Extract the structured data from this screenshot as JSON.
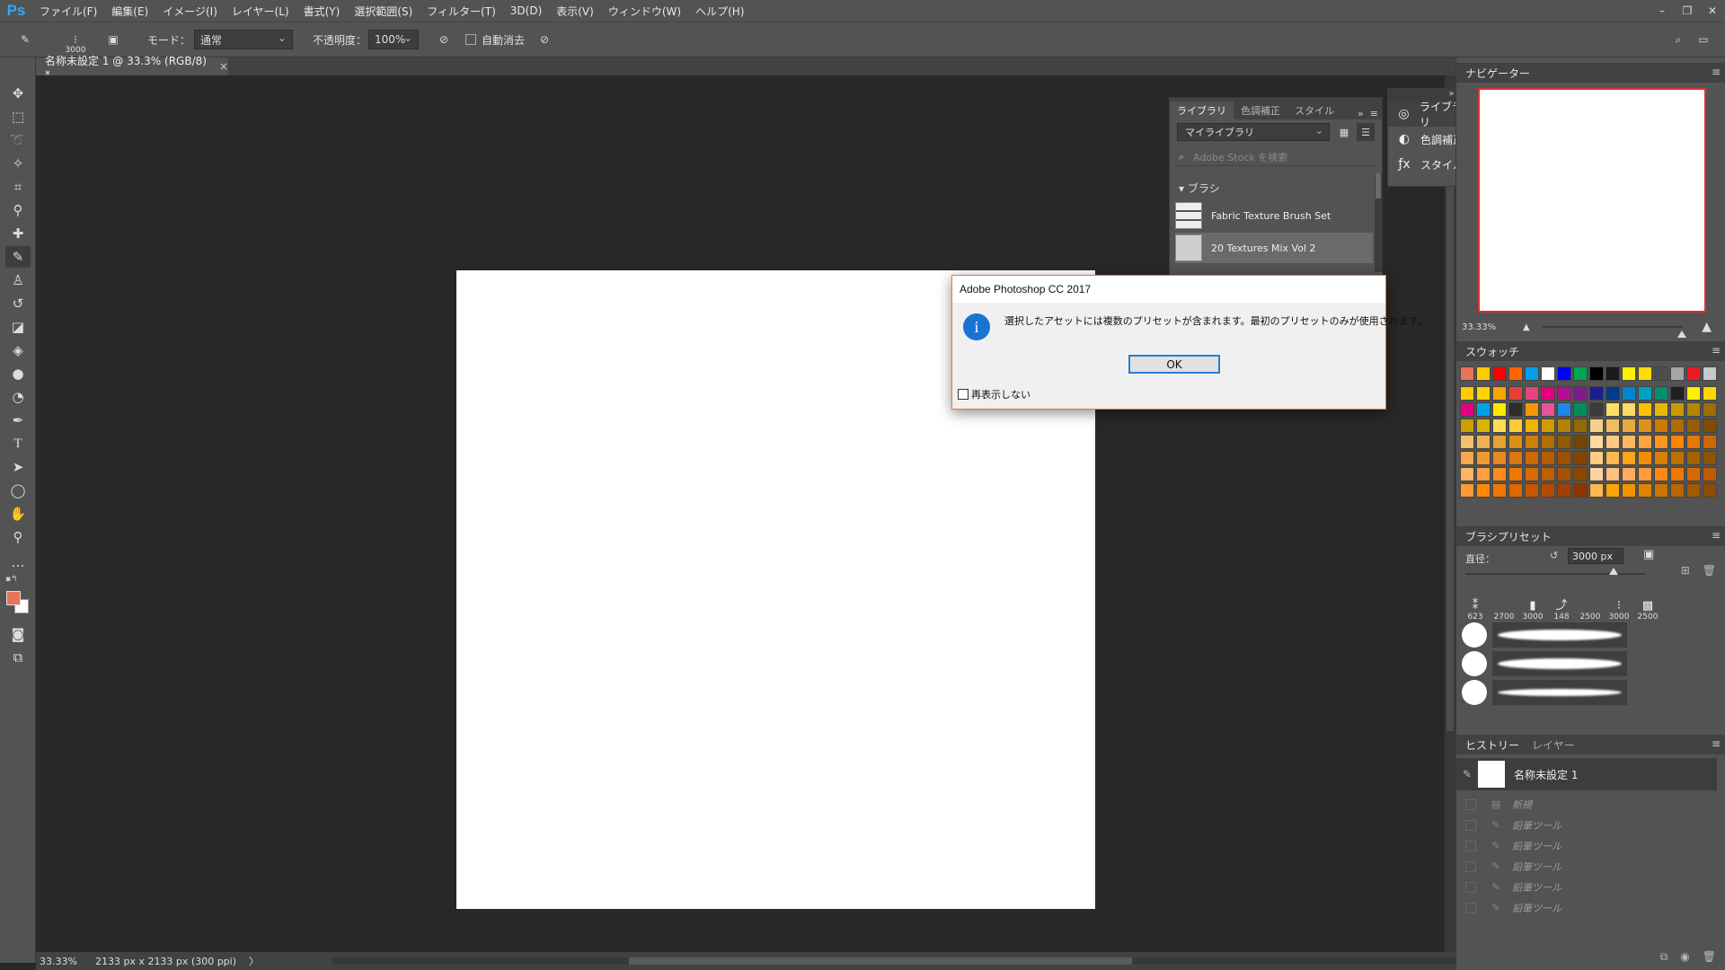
{
  "app": {
    "logo": "Ps"
  },
  "menu": [
    "ファイル(F)",
    "編集(E)",
    "イメージ(I)",
    "レイヤー(L)",
    "書式(Y)",
    "選択範囲(S)",
    "フィルター(T)",
    "3D(D)",
    "表示(V)",
    "ウィンドウ(W)",
    "ヘルプ(H)"
  ],
  "window_controls": {
    "minimize": "–",
    "restore": "❐",
    "close": "✕"
  },
  "options": {
    "brush_size": "3000",
    "mode_label": "モード：",
    "mode_value": "通常",
    "opacity_label": "不透明度：",
    "opacity_value": "100%",
    "auto_erase_label": "自動消去"
  },
  "document": {
    "tab_title": "名称未設定 1 @ 33.3% (RGB/8) *",
    "close": "×"
  },
  "status": {
    "zoom": "33.33%",
    "info": "2133 px x 2133 px (300 ppi)",
    "arrow": "〉"
  },
  "libraries": {
    "tabs": [
      "ライブラリ",
      "色調補正",
      "スタイル"
    ],
    "library_select": "マイライブラリ",
    "search_placeholder": "Adobe Stock を検索",
    "section": "▾ ブラシ",
    "items": [
      "Fabric Texture Brush Set",
      "20 Textures Mix Vol 2"
    ]
  },
  "dock": {
    "items": [
      "ライブラリ",
      "色調補正",
      "スタイル"
    ]
  },
  "navigator": {
    "title": "ナビゲーター",
    "zoom": "33.33%"
  },
  "swatches": {
    "title": "スウォッチ",
    "row0": [
      "#e87358",
      "#ffcc00",
      "#ff0000",
      "#ff6600",
      "#00a0e9",
      "#ffffff",
      "#0000ff",
      "#00a651",
      "#000000",
      "#1a1a1a",
      "#fff200",
      "#ffde00",
      "#4d4d4d",
      "#a6a6a6",
      "#ed1c24",
      "#c8c8c8"
    ],
    "rows": [
      [
        "#ffcc00",
        "#ffd400",
        "#f7a600",
        "#e63f3b",
        "#e4457f",
        "#e4007f",
        "#b30e8f",
        "#7e1c8e",
        "#1d1d8f",
        "#003b8e",
        "#0086d1",
        "#00a0c6",
        "#008f6f",
        "#1f1f1f",
        "#fff000",
        "#ffd700"
      ],
      [
        "#e4007f",
        "#00a0e9",
        "#ffe800",
        "#2d2d2d",
        "#f39800",
        "#e85298",
        "#1e88e5",
        "#008e5a",
        "#3e3a39",
        "#ffe066",
        "#ffd966",
        "#ffc000",
        "#e6b800",
        "#cc9900",
        "#b38600",
        "#996f00"
      ],
      [
        "#c8a000",
        "#d9b300",
        "#ffdd55",
        "#ffcc33",
        "#f0b400",
        "#d19c00",
        "#b08400",
        "#8f6b00",
        "#f5d28c",
        "#f0c060",
        "#e8a840",
        "#e09020",
        "#cc7a00",
        "#b36b00",
        "#995c00",
        "#804d00"
      ],
      [
        "#f5c06b",
        "#f0b050",
        "#e8a030",
        "#dd8f15",
        "#cc7f00",
        "#b06e00",
        "#8f5a00",
        "#704600",
        "#ffd9a0",
        "#ffc880",
        "#ffb760",
        "#ffa640",
        "#ff9520",
        "#ff8400",
        "#e67700",
        "#cc6a00"
      ],
      [
        "#f7a84a",
        "#f29830",
        "#e88820",
        "#dd7810",
        "#d06800",
        "#b85c00",
        "#9e4f00",
        "#854200",
        "#ffcc80",
        "#ffb84d",
        "#ffa31a",
        "#f28f00",
        "#d98000",
        "#bf7100",
        "#a66200",
        "#8c5300"
      ],
      [
        "#ffb366",
        "#ff9f40",
        "#ff8c1a",
        "#f07800",
        "#d96b00",
        "#c05f00",
        "#a65200",
        "#8c4600",
        "#ffd1a3",
        "#ffbf80",
        "#ffad5c",
        "#ff9b38",
        "#ff8914",
        "#f07800",
        "#d66a00",
        "#bd5d00"
      ],
      [
        "#ff9933",
        "#ff8800",
        "#f27700",
        "#e06600",
        "#cc5500",
        "#b84a00",
        "#a33f00",
        "#8f3400",
        "#ffb84d",
        "#ffa500",
        "#f29400",
        "#e08300",
        "#cc7300",
        "#b86600",
        "#a35900",
        "#8f4c00"
      ]
    ]
  },
  "brush_presets": {
    "title": "ブラシプリセット",
    "size_label": "直径：",
    "size_value": "3000 px",
    "tips": [
      "623",
      "2700",
      "3000",
      "148",
      "2500",
      "3000",
      "2500"
    ]
  },
  "history": {
    "tabs": [
      "ヒストリー",
      "レイヤー"
    ],
    "snapshot": "名称未設定 1",
    "items": [
      "新規",
      "鉛筆ツール",
      "鉛筆ツール",
      "鉛筆ツール",
      "鉛筆ツール",
      "鉛筆ツール"
    ]
  },
  "dialog": {
    "title": "Adobe Photoshop CC 2017",
    "message": "選択したアセットには複数のプリセットが含まれます。最初のプリセットのみが使用されます。",
    "ok": "OK",
    "checkbox": "再表示しない",
    "icon": "i"
  }
}
